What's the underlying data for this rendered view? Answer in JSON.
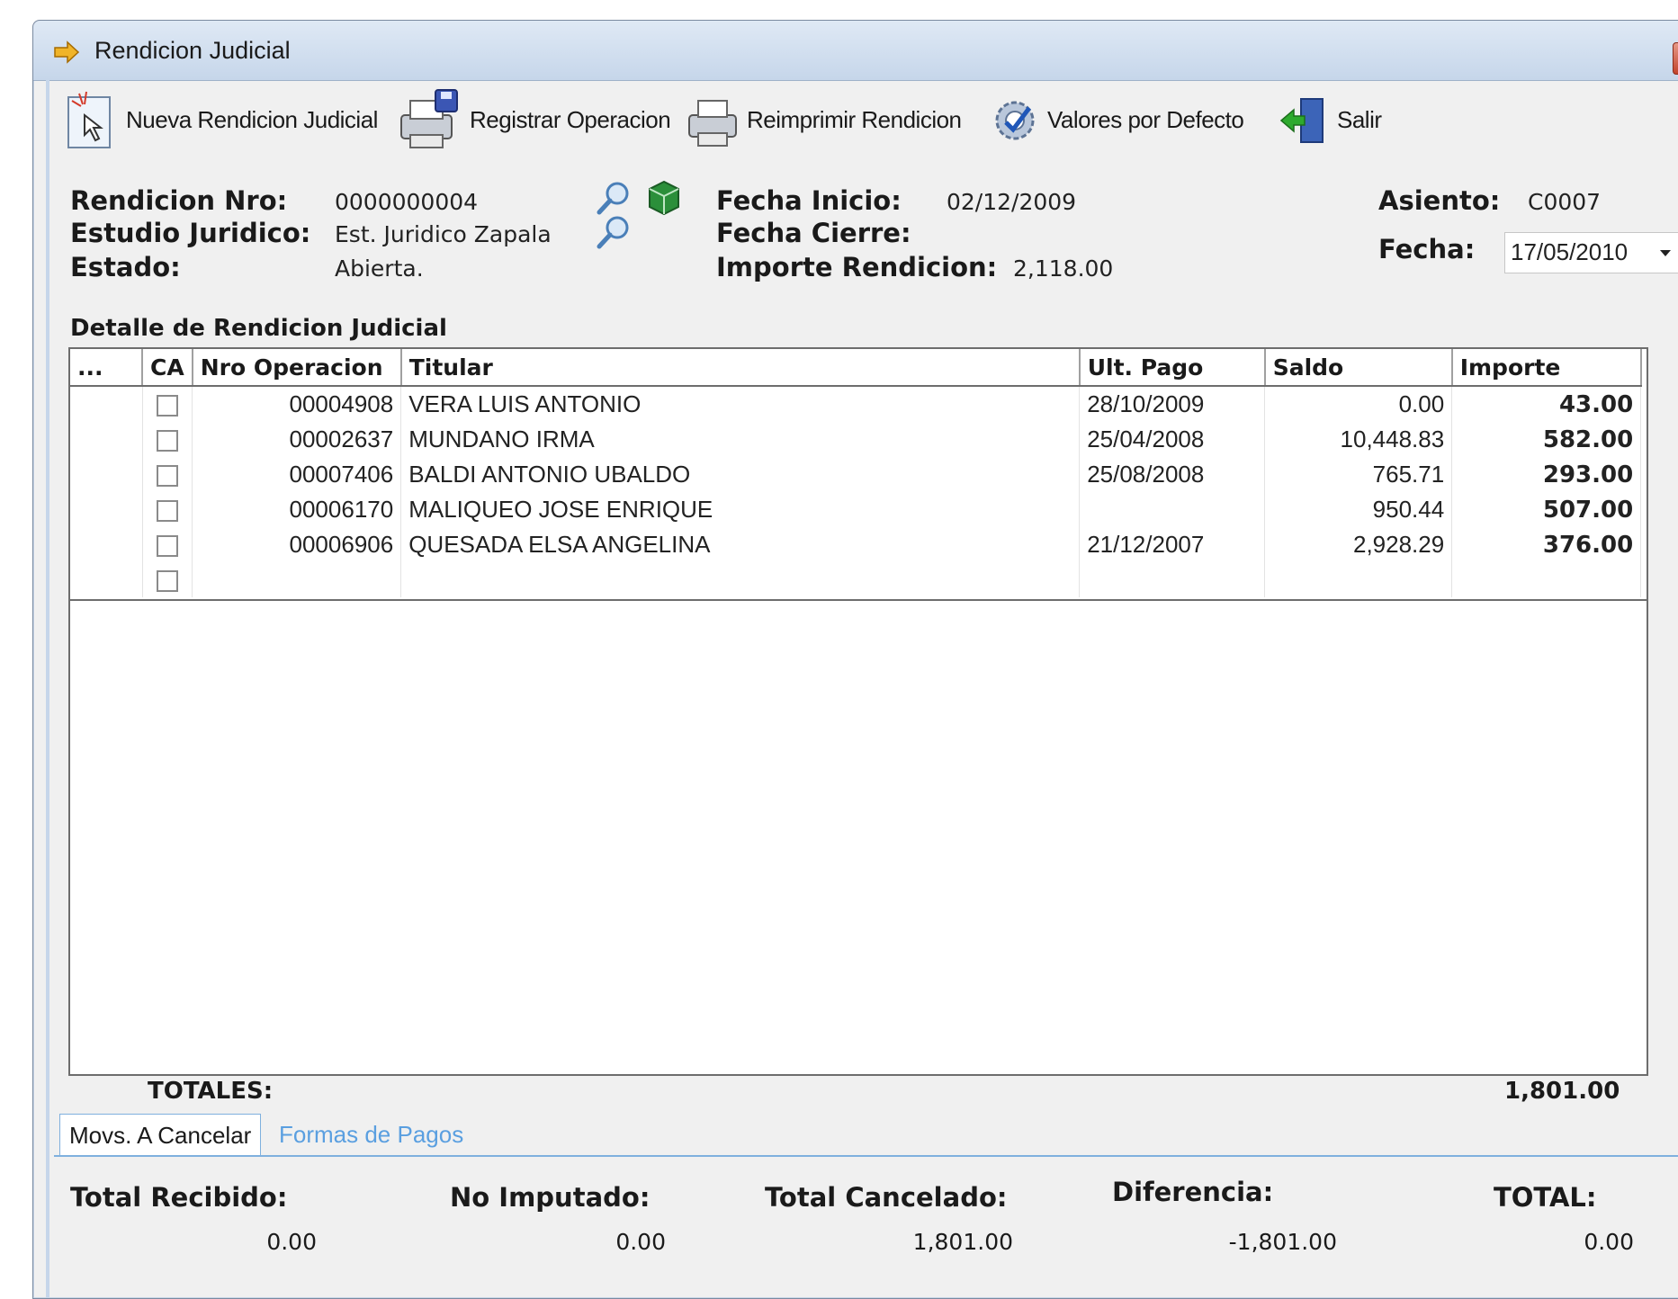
{
  "window": {
    "title": "Rendicion Judicial",
    "close_label": "x"
  },
  "toolbar": {
    "nueva": "Nueva Rendicion Judicial",
    "registrar": "Registrar Operacion",
    "reimprimir": "Reimprimir Rendicion",
    "valores": "Valores por Defecto",
    "salir": "Salir"
  },
  "form": {
    "rendicion_nro_label": "Rendicion Nro:",
    "rendicion_nro": "0000000004",
    "estudio_label": "Estudio Juridico:",
    "estudio": "Est. Juridico Zapala",
    "estado_label": "Estado:",
    "estado": "Abierta.",
    "fecha_inicio_label": "Fecha Inicio:",
    "fecha_inicio": "02/12/2009",
    "fecha_cierre_label": "Fecha Cierre:",
    "importe_label": "Importe Rendicion:",
    "importe": "2,118.00",
    "asiento_label": "Asiento:",
    "asiento": "C0007",
    "fecha_label": "Fecha:",
    "fecha": "17/05/2010"
  },
  "grid": {
    "title": "Detalle de Rendicion Judicial",
    "columns": [
      "...",
      "CA",
      "Nro Operacion",
      "Titular",
      "Ult. Pago",
      "Saldo",
      "Importe"
    ],
    "rows": [
      {
        "nro": "00004908",
        "titular": "VERA LUIS ANTONIO",
        "ult_pago": "28/10/2009",
        "saldo": "0.00",
        "importe": "43.00"
      },
      {
        "nro": "00002637",
        "titular": "MUNDANO IRMA",
        "ult_pago": "25/04/2008",
        "saldo": "10,448.83",
        "importe": "582.00"
      },
      {
        "nro": "00007406",
        "titular": "BALDI ANTONIO UBALDO",
        "ult_pago": "25/08/2008",
        "saldo": "765.71",
        "importe": "293.00"
      },
      {
        "nro": "00006170",
        "titular": "MALIQUEO JOSE ENRIQUE",
        "ult_pago": "",
        "saldo": "950.44",
        "importe": "507.00"
      },
      {
        "nro": "00006906",
        "titular": "QUESADA ELSA ANGELINA",
        "ult_pago": "21/12/2007",
        "saldo": "2,928.29",
        "importe": "376.00"
      },
      {
        "nro": "",
        "titular": "",
        "ult_pago": "",
        "saldo": "",
        "importe": ""
      }
    ],
    "totales_label": "TOTALES:",
    "totales_value": "1,801.00"
  },
  "tabs": [
    "Movs. A Cancelar",
    "Formas de Pagos"
  ],
  "footer": {
    "total_recibido_label": "Total Recibido:",
    "total_recibido": "0.00",
    "no_imputado_label": "No Imputado:",
    "no_imputado": "0.00",
    "total_cancelado_label": "Total Cancelado:",
    "total_cancelado": "1,801.00",
    "diferencia_label": "Diferencia:",
    "diferencia": "-1,801.00",
    "total_label": "TOTAL:",
    "total": "0.00"
  }
}
